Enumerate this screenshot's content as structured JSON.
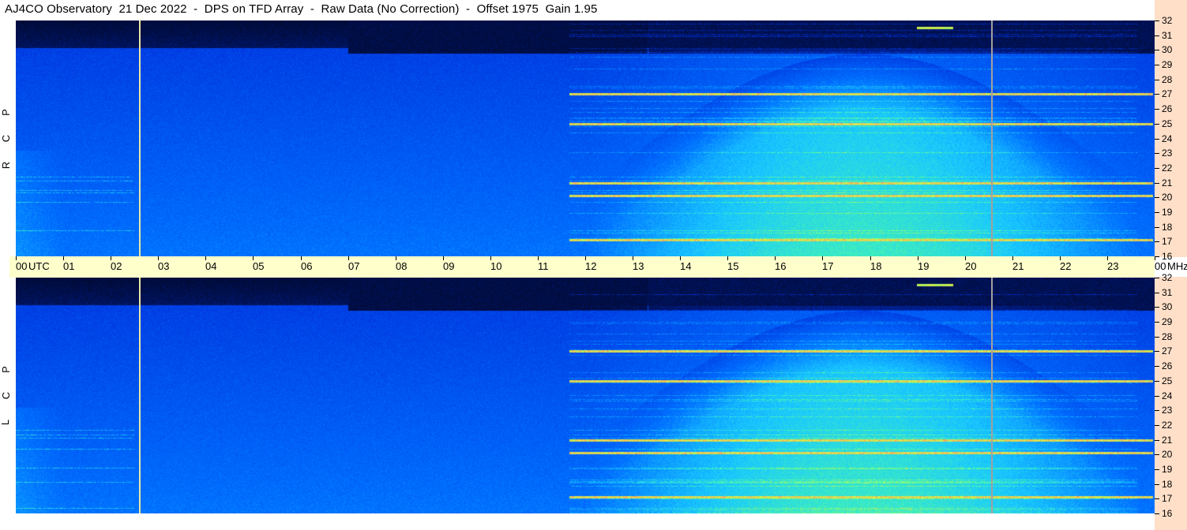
{
  "title": "AJ4CO Observatory  21 Dec 2022  -  DPS on TFD Array  -  Raw Data (No Correction)  -  Offset 1975  Gain 1.95",
  "time_axis": {
    "labels": [
      "00",
      "UTC",
      "01",
      "02",
      "03",
      "04",
      "05",
      "06",
      "07",
      "08",
      "09",
      "10",
      "11",
      "12",
      "13",
      "14",
      "15",
      "16",
      "17",
      "18",
      "19",
      "20",
      "21",
      "22",
      "23",
      "00"
    ],
    "unit_end": "MHz"
  },
  "freq_axis": {
    "labels": [
      "32",
      "31",
      "30",
      "29",
      "28",
      "27",
      "26",
      "25",
      "24",
      "23",
      "22",
      "21",
      "20",
      "19",
      "18",
      "17",
      "16"
    ]
  },
  "panels": [
    {
      "polarization_letters": [
        "P",
        "C",
        "R"
      ]
    },
    {
      "polarization_letters": [
        "P",
        "C",
        "L"
      ]
    }
  ],
  "colors": {
    "background": "#ffffff",
    "time_axis_bg": "#ffffcc",
    "freq_axis_bg": "#ffdfc8",
    "spectrogram_dark": "#000820",
    "spectrogram_blue": "#0044ff",
    "spectrogram_cyan": "#19c8ff",
    "spectrogram_green": "#4cff9a",
    "spectrogram_yellow": "#e6f040",
    "marker_yellow": "#e8e8a0",
    "marker_gray": "#a0a0a0"
  },
  "chart_data": {
    "type": "heatmap",
    "title": "AJ4CO Observatory  21 Dec 2022  -  DPS on TFD Array  -  Raw Data (No Correction)  -  Offset 1975  Gain 1.95",
    "xlabel": "UTC",
    "ylabel": "MHz",
    "x_range_utc_hours": [
      0,
      24
    ],
    "y_range_mhz": [
      16,
      32
    ],
    "x_ticks": [
      "00",
      "01",
      "02",
      "03",
      "04",
      "05",
      "06",
      "07",
      "08",
      "09",
      "10",
      "11",
      "12",
      "13",
      "14",
      "15",
      "16",
      "17",
      "18",
      "19",
      "20",
      "21",
      "22",
      "23",
      "00"
    ],
    "y_ticks": [
      32,
      31,
      30,
      29,
      28,
      27,
      26,
      25,
      24,
      23,
      22,
      21,
      20,
      19,
      18,
      17,
      16
    ],
    "series": [
      {
        "name": "RCP",
        "polarization": "R C P"
      },
      {
        "name": "LCP",
        "polarization": "L C P"
      }
    ],
    "vertical_markers_utc": [
      2.6,
      20.55
    ],
    "strong_interference_mhz": [
      17.1,
      20.1,
      21.0,
      25.0,
      27.0,
      31.5
    ],
    "daytime_activity_utc": [
      12.0,
      23.7
    ]
  }
}
